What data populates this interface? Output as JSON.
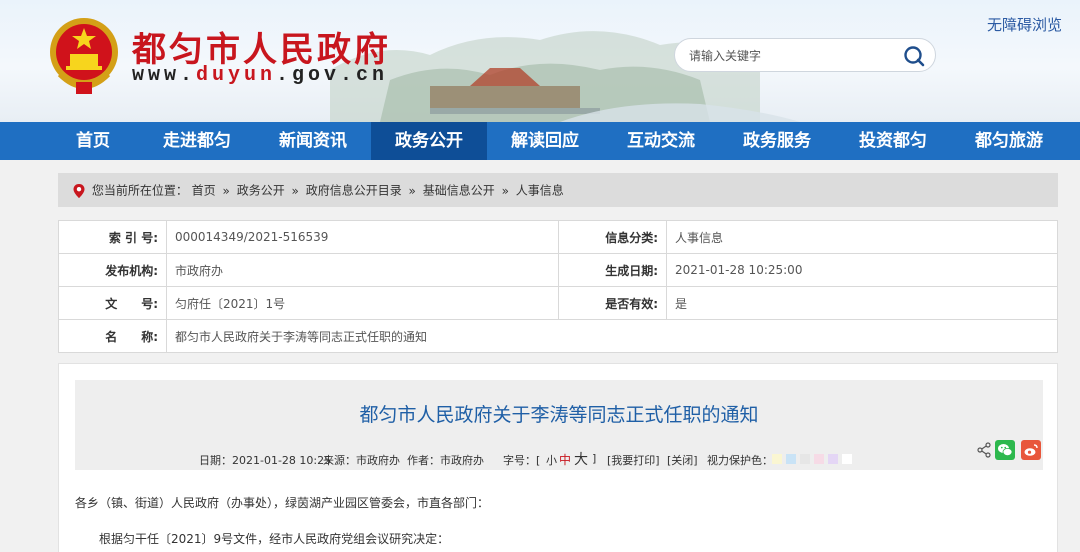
{
  "header": {
    "site_title": "都匀市人民政府",
    "site_url_prefix": "www.",
    "site_url_highlight": "duyun",
    "site_url_suffix": ".gov.cn",
    "accessibility_link": "无障碍浏览",
    "search_placeholder": "请输入关键字"
  },
  "nav": {
    "items": [
      "首页",
      "走进都匀",
      "新闻资讯",
      "政务公开",
      "解读回应",
      "互动交流",
      "政务服务",
      "投资都匀",
      "都匀旅游"
    ],
    "active_index": 3
  },
  "breadcrumb": {
    "prefix": "您当前所在位置：",
    "items": [
      "首页",
      "政务公开",
      "政府信息公开目录",
      "基础信息公开",
      "人事信息"
    ],
    "separator": "»"
  },
  "info": {
    "index_label": "索 引 号:",
    "index_value": "000014349/2021-516539",
    "category_label": "信息分类:",
    "category_value": "人事信息",
    "publisher_label": "发布机构:",
    "publisher_value": "市政府办",
    "date_label": "生成日期:",
    "date_value": "2021-01-28 10:25:00",
    "doc_label": "文　　号:",
    "doc_value": "匀府任〔2021〕1号",
    "valid_label": "是否有效:",
    "valid_value": "是",
    "name_label": "名　　称:",
    "name_value": "都匀市人民政府关于李涛等同志正式任职的通知"
  },
  "article": {
    "title": "都匀市人民政府关于李涛等同志正式任职的通知",
    "meta": {
      "date": "日期：2021-01-28 10:25",
      "source": "来源：市政府办",
      "author": "作者：市政府办",
      "font_size_label": "字号：[",
      "font_small": "小",
      "font_medium": "中",
      "font_large": "大",
      "font_close": "]",
      "print": "[我要打印]",
      "close": "[关闭]",
      "eye_label": "视力保护色："
    },
    "eye_colors": [
      "#faf6d2",
      "#c9e3f6",
      "#e6e6e6",
      "#f6dbe6",
      "#e4d6f5",
      "#ffffff"
    ],
    "salutation": "各乡（镇、街道）人民政府（办事处），绿茵湖产业园区管委会，市直各部门：",
    "paragraph_1": "根据匀干任〔2021〕9号文件，经市人民政府党组会议研究决定："
  },
  "colors": {
    "brand_red": "#c8161e",
    "nav_blue": "#1f6fc2",
    "nav_active": "#0e4e97",
    "title_blue": "#1f5fa6"
  }
}
